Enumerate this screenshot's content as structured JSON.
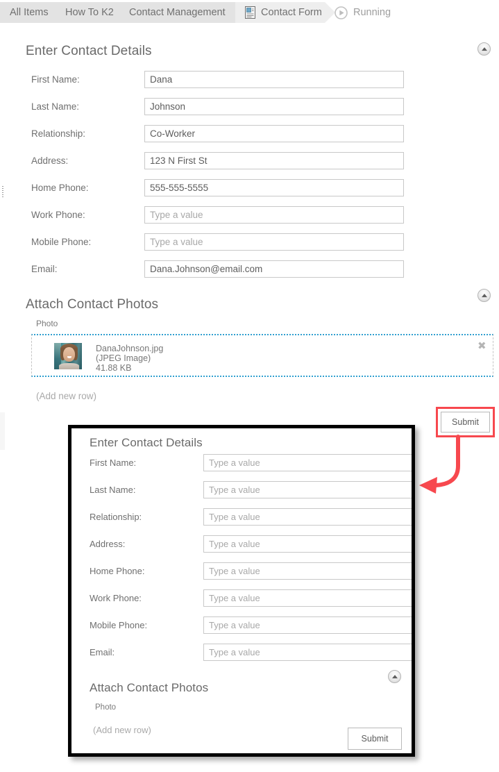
{
  "breadcrumb": {
    "items": [
      {
        "label": "All Items",
        "icon": null,
        "state": "normal"
      },
      {
        "label": "How To K2",
        "icon": null,
        "state": "normal"
      },
      {
        "label": "Contact Management",
        "icon": null,
        "state": "normal"
      },
      {
        "label": "Contact Form",
        "icon": "document-icon",
        "state": "active"
      },
      {
        "label": "Running",
        "icon": "play-icon",
        "state": "muted"
      }
    ]
  },
  "main_form": {
    "details_section": {
      "title": "Enter Contact Details",
      "collapse_icon": "chevron-up-circle-icon",
      "fields": [
        {
          "label": "First Name:",
          "value": "Dana",
          "placeholder": "Type a value",
          "filled": true
        },
        {
          "label": "Last Name:",
          "value": "Johnson",
          "placeholder": "Type a value",
          "filled": true
        },
        {
          "label": "Relationship:",
          "value": "Co-Worker",
          "placeholder": "Type a value",
          "filled": true
        },
        {
          "label": "Address:",
          "value": "123 N First St",
          "placeholder": "Type a value",
          "filled": true
        },
        {
          "label": "Home Phone:",
          "value": "555-555-5555",
          "placeholder": "Type a value",
          "filled": true
        },
        {
          "label": "Work Phone:",
          "value": "Type a value",
          "placeholder": "Type a value",
          "filled": false
        },
        {
          "label": "Mobile Phone:",
          "value": "Type a value",
          "placeholder": "Type a value",
          "filled": false
        },
        {
          "label": "Email:",
          "value": "Dana.Johnson@email.com",
          "placeholder": "Type a value",
          "filled": true
        }
      ]
    },
    "photos_section": {
      "title": "Attach Contact Photos",
      "collapse_icon": "chevron-up-circle-icon",
      "column_header": "Photo",
      "attachment": {
        "thumbnail": "contact-photo-thumbnail",
        "file_name": "DanaJohnson.jpg",
        "file_type": "(JPEG Image)",
        "file_size": "41.88 KB",
        "remove_icon": "close-icon"
      },
      "add_row_label": "(Add new row)"
    },
    "submit_label": "Submit"
  },
  "inset_panel": {
    "details_section": {
      "title": "Enter Contact Details",
      "fields": [
        {
          "label": "First Name:",
          "value": "Type a value"
        },
        {
          "label": "Last Name:",
          "value": "Type a value"
        },
        {
          "label": "Relationship:",
          "value": "Type a value"
        },
        {
          "label": "Address:",
          "value": "Type a value"
        },
        {
          "label": "Home Phone:",
          "value": "Type a value"
        },
        {
          "label": "Work Phone:",
          "value": "Type a value"
        },
        {
          "label": "Mobile Phone:",
          "value": "Type a value"
        },
        {
          "label": "Email:",
          "value": "Type a value"
        }
      ]
    },
    "photos_section": {
      "title": "Attach Contact Photos",
      "collapse_icon": "chevron-up-circle-icon",
      "column_header": "Photo",
      "add_row_label": "(Add new row)"
    },
    "submit_label": "Submit"
  },
  "annotations": {
    "highlight_color": "#f7484e",
    "arrow_color": "#f7484e",
    "arrow_icon": "curved-arrow-left-icon",
    "highlight_target": "Submit"
  },
  "colors": {
    "breadcrumb_bg": "#e3e3e3",
    "breadcrumb_active_bg": "#eeeeee",
    "text": "#6f6f6f",
    "placeholder": "#a8a8a8",
    "input_border": "#c8c8c8",
    "attach_accent": "#2f9fd0"
  }
}
